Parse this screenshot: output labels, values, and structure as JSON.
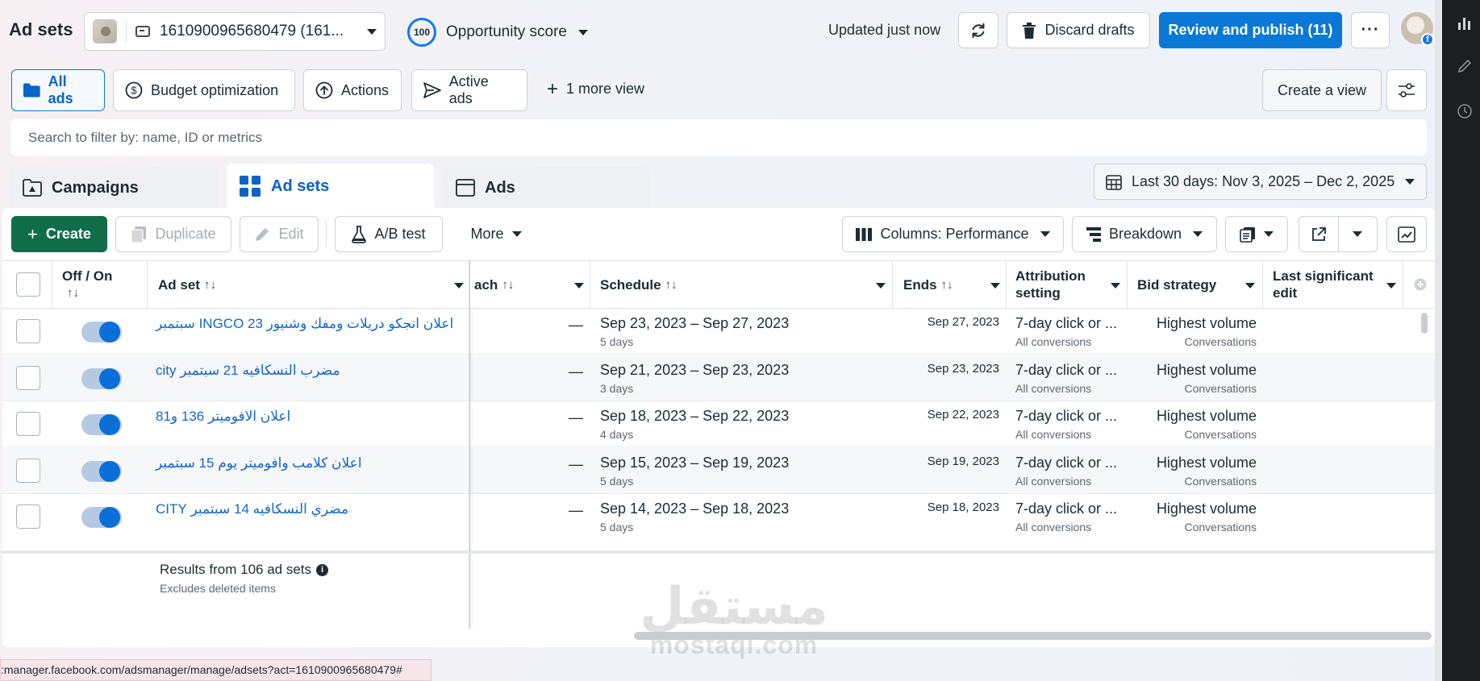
{
  "header": {
    "title": "Ad sets",
    "account": "1610900965680479 (161...",
    "opportunity_score_value": "100",
    "opportunity_score_label": "Opportunity score",
    "updated_text": "Updated just now",
    "discard_label": "Discard drafts",
    "publish_label": "Review and publish (11)",
    "more_label": "···",
    "avatar_badge": "f"
  },
  "views": {
    "all_ads": "All ads",
    "budget_optimization": "Budget optimization",
    "actions": "Actions",
    "active_ads": "Active ads",
    "more_view": "1 more view",
    "create_view": "Create a view"
  },
  "search": {
    "placeholder": "Search to filter by: name, ID or metrics"
  },
  "tabs": {
    "campaigns": "Campaigns",
    "ad_sets": "Ad sets",
    "ads": "Ads"
  },
  "date_range": "Last 30 days: Nov 3, 2025 – Dec 2, 2025",
  "toolbar": {
    "create": "Create",
    "duplicate": "Duplicate",
    "edit": "Edit",
    "ab_test": "A/B test",
    "more": "More",
    "columns": "Columns: Performance",
    "breakdown": "Breakdown"
  },
  "table": {
    "headers": {
      "off_on": "Off / On",
      "ad_set": "Ad set",
      "reach": "ach",
      "schedule": "Schedule",
      "ends": "Ends",
      "attribution_1": "Attribution",
      "attribution_2": "setting",
      "bid_strategy": "Bid strategy",
      "last_edit_1": "Last significant",
      "last_edit_2": "edit",
      "sort_glyph": "↑↓"
    },
    "rows": [
      {
        "name": "اعلان انجكو دريلات ومفك وشنيور INGCO 23 سبتمبر",
        "reach": "—",
        "schedule": "Sep 23, 2023 – Sep 27, 2023",
        "duration": "5 days",
        "ends": "Sep 27, 2023",
        "attribution": "7-day click or ...",
        "attribution_sub": "All conversions",
        "bid": "Highest volume",
        "bid_sub": "Conversations",
        "on": true
      },
      {
        "name": "مضرب النسكافيه 21 سبتمبر city",
        "reach": "—",
        "schedule": "Sep 21, 2023 – Sep 23, 2023",
        "duration": "3 days",
        "ends": "Sep 23, 2023",
        "attribution": "7-day click or ...",
        "attribution_sub": "All conversions",
        "bid": "Highest volume",
        "bid_sub": "Conversations",
        "on": true
      },
      {
        "name": "اعلان الافوميتر 136 و81",
        "reach": "—",
        "schedule": "Sep 18, 2023 – Sep 22, 2023",
        "duration": "4 days",
        "ends": "Sep 22, 2023",
        "attribution": "7-day click or ...",
        "attribution_sub": "All conversions",
        "bid": "Highest volume",
        "bid_sub": "Conversations",
        "on": true
      },
      {
        "name": "اعلان كلامب وافوميتر يوم 15 سبتمبر",
        "reach": "—",
        "schedule": "Sep 15, 2023 – Sep 19, 2023",
        "duration": "5 days",
        "ends": "Sep 19, 2023",
        "attribution": "7-day click or ...",
        "attribution_sub": "All conversions",
        "bid": "Highest volume",
        "bid_sub": "Conversations",
        "on": true
      },
      {
        "name": "مضري النسكافيه 14 سبتمبر CITY",
        "reach": "—",
        "schedule": "Sep 14, 2023 – Sep 18, 2023",
        "duration": "5 days",
        "ends": "Sep 18, 2023",
        "attribution": "7-day click or ...",
        "attribution_sub": "All conversions",
        "bid": "Highest volume",
        "bid_sub": "Conversations",
        "on": true
      }
    ],
    "results": "Results from 106 ad sets",
    "results_note": "Excludes deleted items"
  },
  "status_url": ":manager.facebook.com/adsmanager/manage/adsets?act=1610900965680479#",
  "watermark": {
    "arabic": "مستقل",
    "latin": "mostaql.com"
  },
  "colors": {
    "primary": "#0a78d7",
    "create_green": "#0f6d4a",
    "link": "#1266c9"
  }
}
